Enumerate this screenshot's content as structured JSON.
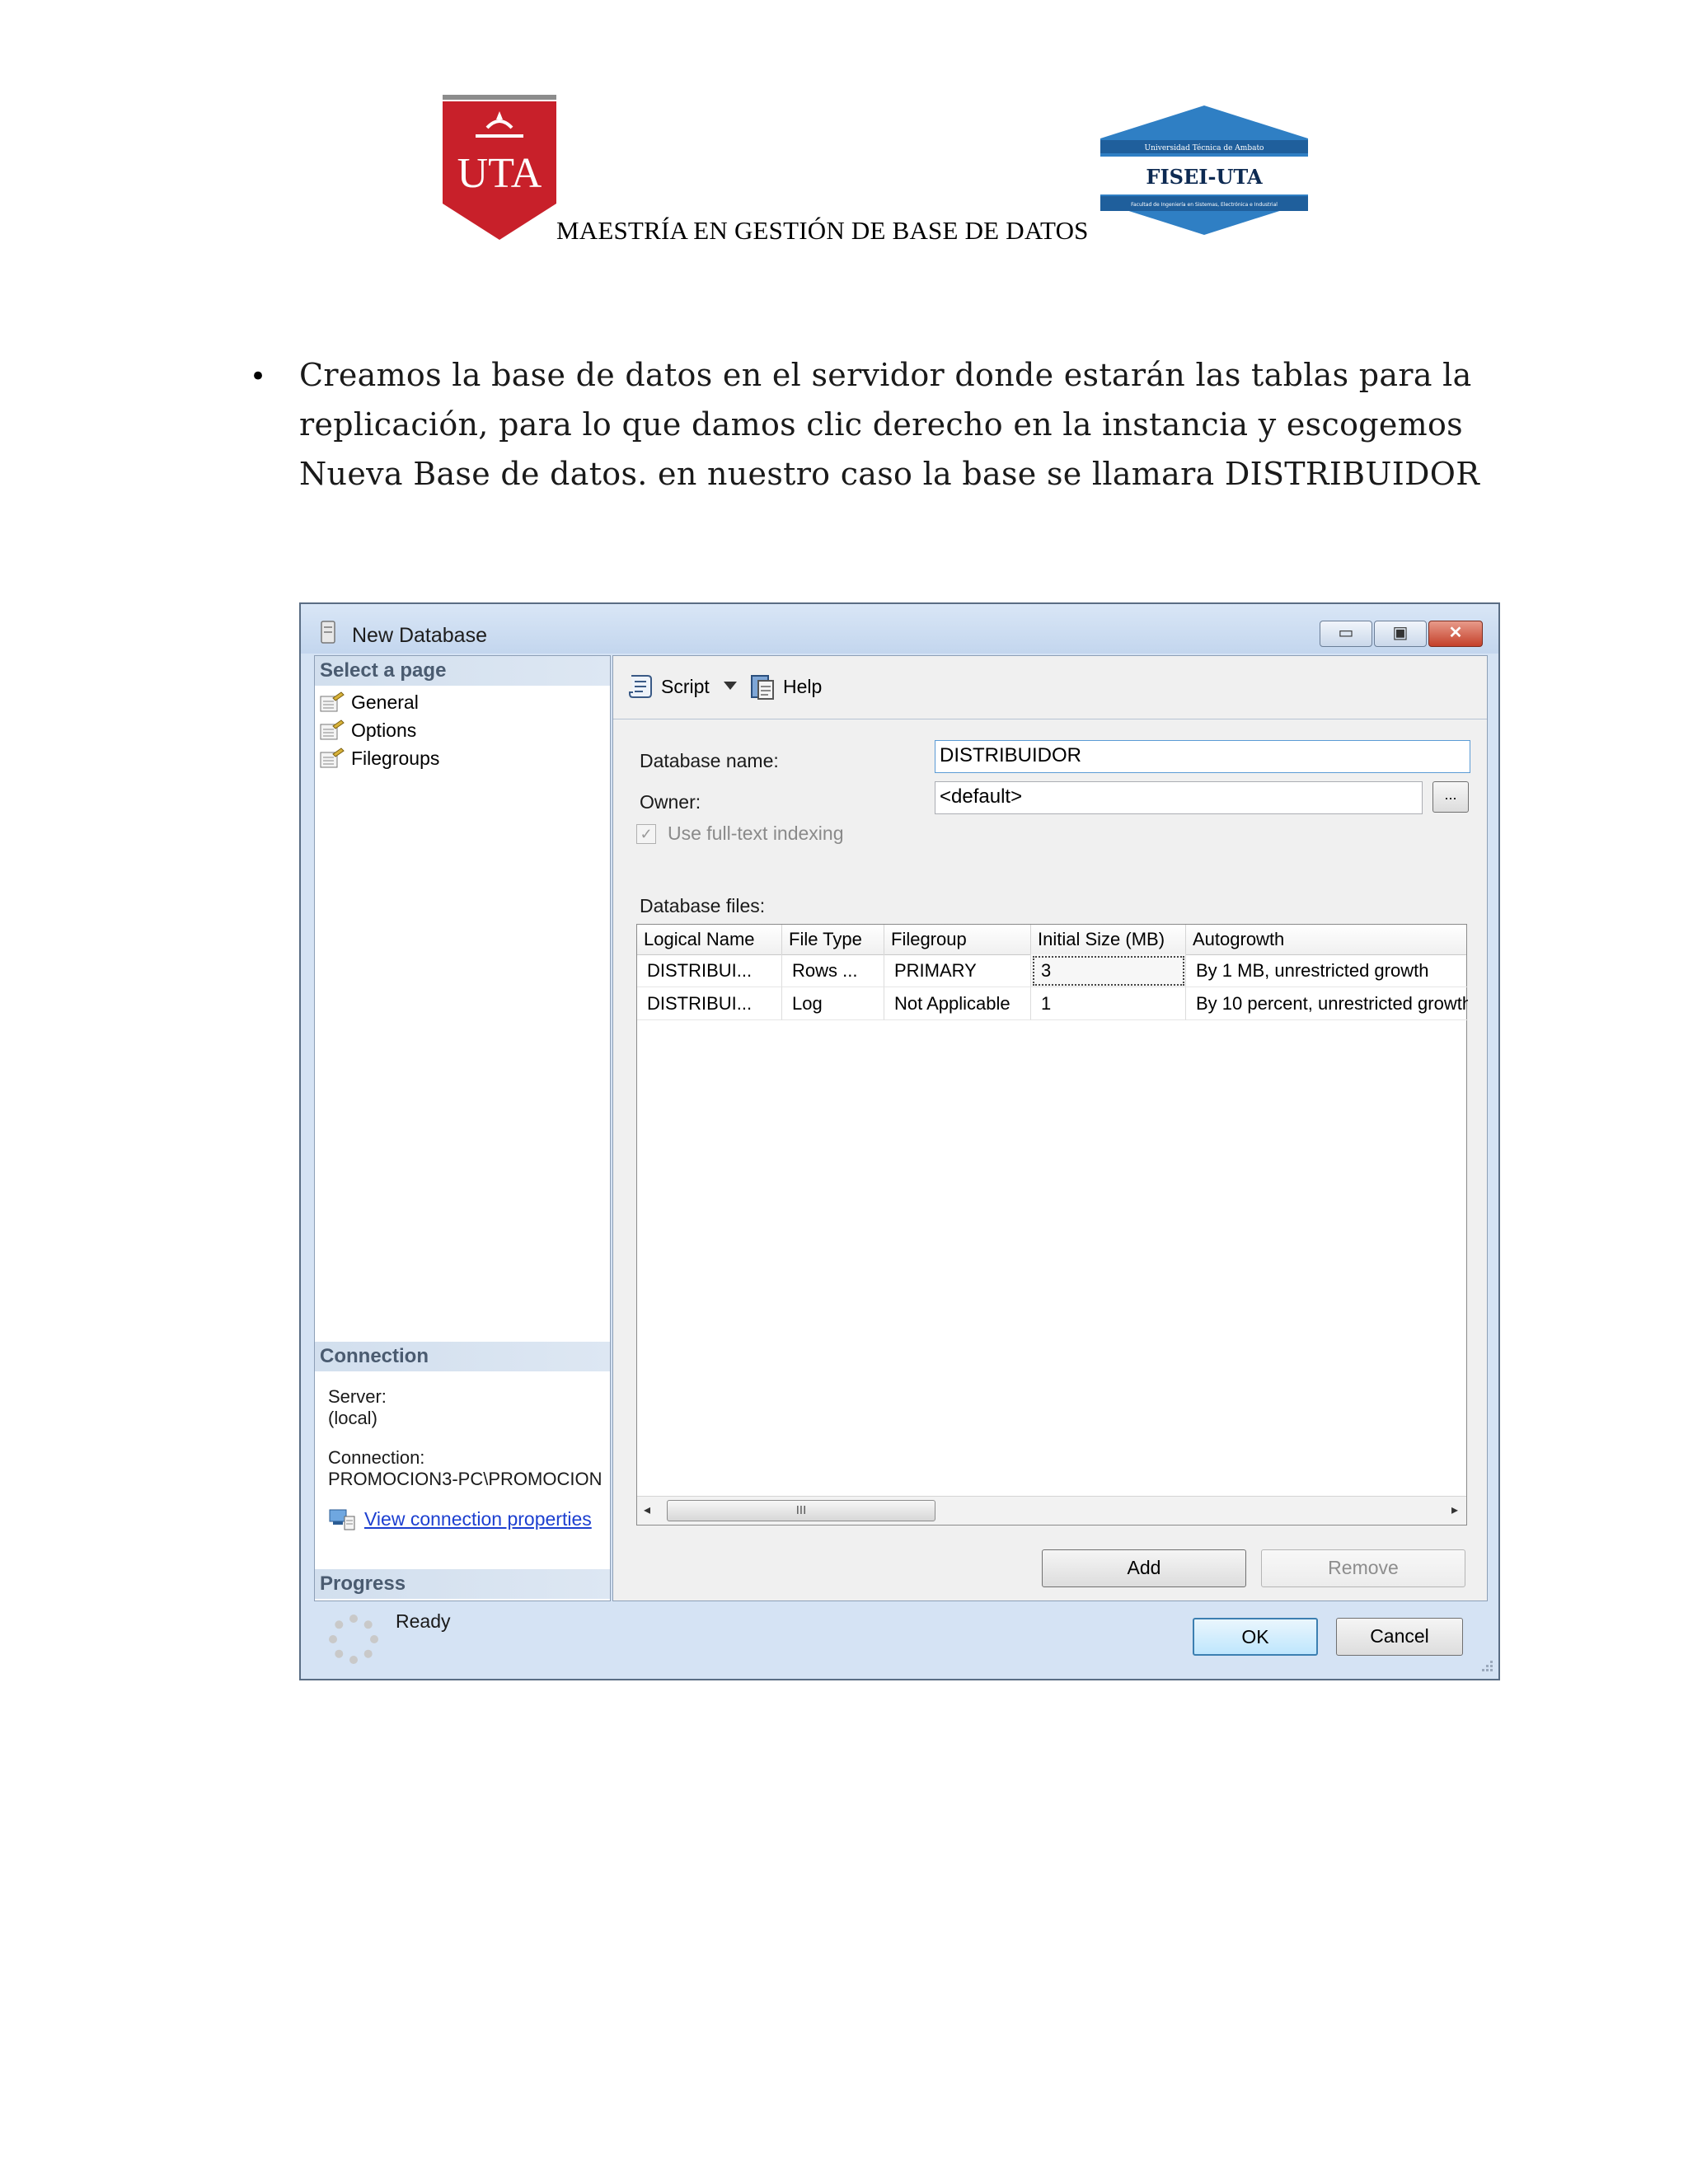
{
  "header": {
    "left_logo_text": "UTA",
    "right_logo_line1": "Universidad Técnica de Ambato",
    "right_logo_name": "FISEI-UTA",
    "right_logo_line2": "Facultad de Ingeniería en Sistemas, Electrónica e Industrial",
    "title": "MAESTRÍA EN GESTIÓN DE BASE DE DATOS"
  },
  "paragraph": {
    "bullet": "•",
    "text": "Creamos la base de datos en el servidor donde estarán las tablas para la replicación, para lo que damos clic derecho en la instancia y escogemos Nueva Base de datos. en nuestro caso la base se llamara DISTRIBUIDOR"
  },
  "dialog": {
    "title": "New Database",
    "window_buttons": {
      "minimize": "▭",
      "maximize": "▣",
      "close": "✕"
    },
    "select_page": {
      "heading": "Select a page",
      "items": [
        "General",
        "Options",
        "Filegroups"
      ]
    },
    "connection": {
      "heading": "Connection",
      "server_label": "Server:",
      "server_value": "(local)",
      "connection_label": "Connection:",
      "connection_value": "PROMOCION3-PC\\PROMOCION",
      "link": "View connection properties"
    },
    "progress": {
      "heading": "Progress",
      "status": "Ready"
    },
    "toolbar": {
      "script": "Script",
      "help": "Help"
    },
    "form": {
      "db_name_label": "Database name:",
      "db_name_value": "DISTRIBUIDOR",
      "owner_label": "Owner:",
      "owner_value": "<default>",
      "browse": "...",
      "fulltext_label": "Use full-text indexing",
      "fulltext_check": "✓",
      "files_label": "Database files:"
    },
    "grid": {
      "columns": [
        "Logical Name",
        "File Type",
        "Filegroup",
        "Initial Size (MB)",
        "Autogrowth"
      ],
      "rows": [
        [
          "DISTRIBUI...",
          "Rows ...",
          "PRIMARY",
          "3",
          "By 1 MB, unrestricted growth"
        ],
        [
          "DISTRIBUI...",
          "Log",
          "Not Applicable",
          "1",
          "By 10 percent, unrestricted growth"
        ]
      ],
      "scroll_thumb": "III",
      "scroll_left": "◂",
      "scroll_right": "▸"
    },
    "buttons": {
      "add": "Add",
      "remove": "Remove",
      "ok": "OK",
      "cancel": "Cancel"
    }
  }
}
